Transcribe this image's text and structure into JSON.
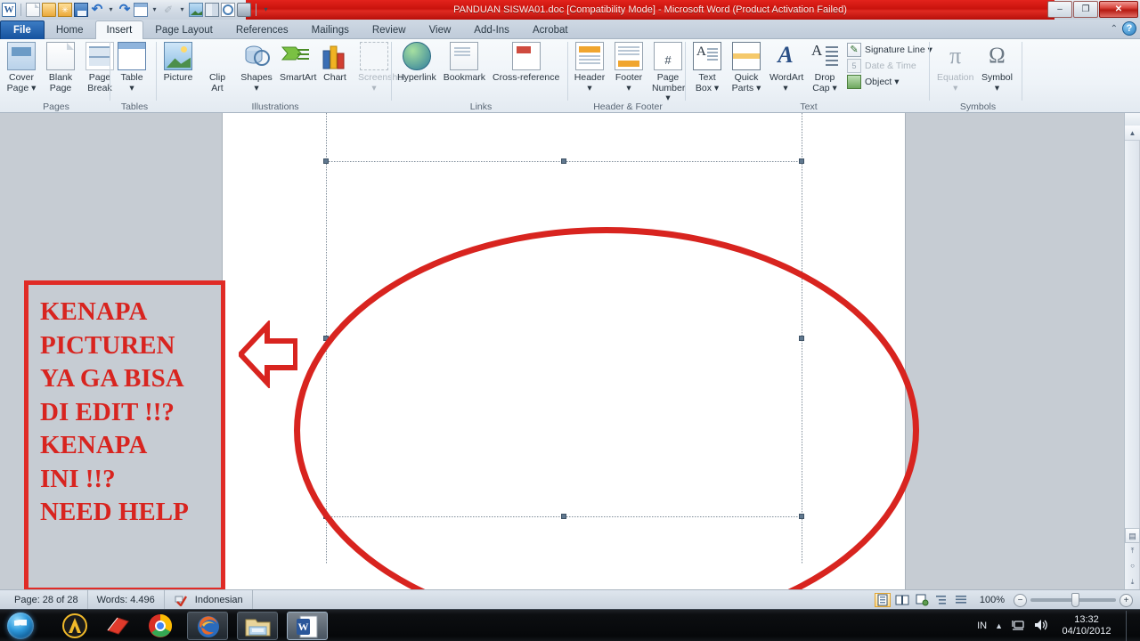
{
  "window": {
    "title": "PANDUAN SISWA01.doc [Compatibility Mode]  -  Microsoft Word (Product Activation Failed)",
    "minimize_label": "–",
    "restore_label": "❐",
    "close_label": "✕"
  },
  "quick_access": {
    "items": [
      {
        "name": "word-logo-icon",
        "label": "W"
      },
      {
        "name": "new-document-icon",
        "label": ""
      },
      {
        "name": "open-folder-icon",
        "label": ""
      },
      {
        "name": "open-recent-icon",
        "label": ""
      },
      {
        "name": "save-icon",
        "label": ""
      },
      {
        "name": "undo-icon",
        "label": "↶"
      },
      {
        "name": "undo-dropdown-icon",
        "label": "▾"
      },
      {
        "name": "redo-icon",
        "label": "↷"
      },
      {
        "name": "table-icon",
        "label": ""
      },
      {
        "name": "table-dropdown-icon",
        "label": "▾"
      },
      {
        "name": "format-painter-icon",
        "label": "✐"
      },
      {
        "name": "format-painter-dropdown-icon",
        "label": "▾"
      },
      {
        "name": "insert-picture-icon",
        "label": ""
      },
      {
        "name": "book-icon",
        "label": ""
      },
      {
        "name": "print-preview-icon",
        "label": ""
      },
      {
        "name": "print-icon",
        "label": ""
      },
      {
        "name": "customize-qat-icon",
        "label": "▾"
      }
    ]
  },
  "tabs": [
    {
      "label": "File",
      "active": false,
      "kind": "file"
    },
    {
      "label": "Home",
      "active": false
    },
    {
      "label": "Insert",
      "active": true
    },
    {
      "label": "Page Layout",
      "active": false
    },
    {
      "label": "References",
      "active": false
    },
    {
      "label": "Mailings",
      "active": false
    },
    {
      "label": "Review",
      "active": false
    },
    {
      "label": "View",
      "active": false
    },
    {
      "label": "Add-Ins",
      "active": false
    },
    {
      "label": "Acrobat",
      "active": false
    }
  ],
  "ribbon_help": {
    "collapse_label": "⌃",
    "help_label": "?"
  },
  "ribbon": {
    "groups": [
      {
        "name": "pages",
        "label": "Pages",
        "buttons": [
          {
            "label": "Cover\nPage ▾",
            "icon": "cover-page-icon",
            "dim": false
          },
          {
            "label": "Blank\nPage",
            "icon": "blank-page-icon",
            "dim": false
          },
          {
            "label": "Page\nBreak",
            "icon": "page-break-icon",
            "dim": false
          }
        ]
      },
      {
        "name": "tables",
        "label": "Tables",
        "buttons": [
          {
            "label": "Table\n▾",
            "icon": "table-icon",
            "dim": false
          }
        ]
      },
      {
        "name": "illustrations",
        "label": "Illustrations",
        "buttons": [
          {
            "label": "Picture",
            "icon": "picture-icon",
            "dim": false
          },
          {
            "label": "Clip\nArt",
            "icon": "clip-art-icon",
            "dim": false
          },
          {
            "label": "Shapes\n▾",
            "icon": "shapes-icon",
            "dim": false
          },
          {
            "label": "SmartArt",
            "icon": "smartart-icon",
            "dim": false
          },
          {
            "label": "Chart",
            "icon": "chart-icon",
            "dim": false
          },
          {
            "label": "Screenshot\n▾",
            "icon": "screenshot-icon",
            "dim": true
          }
        ]
      },
      {
        "name": "links",
        "label": "Links",
        "buttons": [
          {
            "label": "Hyperlink",
            "icon": "hyperlink-icon",
            "dim": false
          },
          {
            "label": "Bookmark",
            "icon": "bookmark-icon",
            "dim": false
          },
          {
            "label": "Cross-reference",
            "icon": "cross-reference-icon",
            "dim": false
          }
        ]
      },
      {
        "name": "header-footer",
        "label": "Header & Footer",
        "buttons": [
          {
            "label": "Header\n▾",
            "icon": "header-icon",
            "dim": false
          },
          {
            "label": "Footer\n▾",
            "icon": "footer-icon",
            "dim": false
          },
          {
            "label": "Page\nNumber ▾",
            "icon": "page-number-icon",
            "dim": false
          }
        ]
      },
      {
        "name": "text",
        "label": "Text",
        "buttons": [
          {
            "label": "Text\nBox ▾",
            "icon": "text-box-icon",
            "dim": false
          },
          {
            "label": "Quick\nParts ▾",
            "icon": "quick-parts-icon",
            "dim": false
          },
          {
            "label": "WordArt\n▾",
            "icon": "wordart-icon",
            "dim": false
          },
          {
            "label": "Drop\nCap ▾",
            "icon": "drop-cap-icon",
            "dim": false
          }
        ],
        "small_items": [
          {
            "label": "Signature Line ▾",
            "icon": "signature-line-icon",
            "dim": false
          },
          {
            "label": "Date & Time",
            "icon": "date-time-icon",
            "dim": true
          },
          {
            "label": "Object ▾",
            "icon": "object-icon",
            "dim": false
          }
        ]
      },
      {
        "name": "symbols",
        "label": "Symbols",
        "buttons": [
          {
            "label": "Equation\n▾",
            "icon": "equation-icon",
            "dim": true
          },
          {
            "label": "Symbol\n▾",
            "icon": "symbol-icon",
            "dim": false
          }
        ]
      }
    ]
  },
  "document": {
    "annotation_text": "KENAPA\nPICTUREN\nYA GA BISA\nDI EDIT !!?\nKENAPA\nINI !!?\nNEED HELP",
    "annotation_color": "#d8241f",
    "ellipse_color": "#d8241f",
    "arrow_color": "#d8241f",
    "page_background": "#ffffff",
    "workspace_background": "#c6ccd3"
  },
  "status_bar": {
    "page": "Page: 28 of 28",
    "words": "Words: 4.496",
    "proofing_icon": "spelling-check-icon",
    "language": "Indonesian",
    "zoom": "100%",
    "zoom_out_label": "−",
    "zoom_in_label": "+",
    "views": [
      {
        "name": "print-layout-view-button",
        "selected": true
      },
      {
        "name": "full-screen-reading-view-button",
        "selected": false
      },
      {
        "name": "web-layout-view-button",
        "selected": false
      },
      {
        "name": "outline-view-button",
        "selected": false
      },
      {
        "name": "draft-view-button",
        "selected": false
      }
    ]
  },
  "scrollbar": {
    "up_label": "▲",
    "down_label": "▼",
    "prev_page_label": "⤒",
    "select_object_label": "○",
    "next_page_label": "⤓",
    "browse_object_label": "▤"
  },
  "taskbar": {
    "start_label": "",
    "items": [
      {
        "name": "taskbar-icon-avira",
        "label": "A",
        "running": false
      },
      {
        "name": "taskbar-icon-dictionary",
        "label": "",
        "running": false
      },
      {
        "name": "taskbar-icon-chrome",
        "label": "",
        "running": false
      },
      {
        "name": "taskbar-button-firefox",
        "label": "",
        "running": true
      },
      {
        "name": "taskbar-button-explorer",
        "label": "",
        "running": true
      },
      {
        "name": "taskbar-button-word",
        "label": "W",
        "running": true,
        "active": true
      }
    ],
    "tray": {
      "language": "IN",
      "show_hidden_label": "▲",
      "network_icon": "network-icon",
      "volume_icon": "volume-icon",
      "time": "13:32",
      "date": "04/10/2012"
    }
  }
}
